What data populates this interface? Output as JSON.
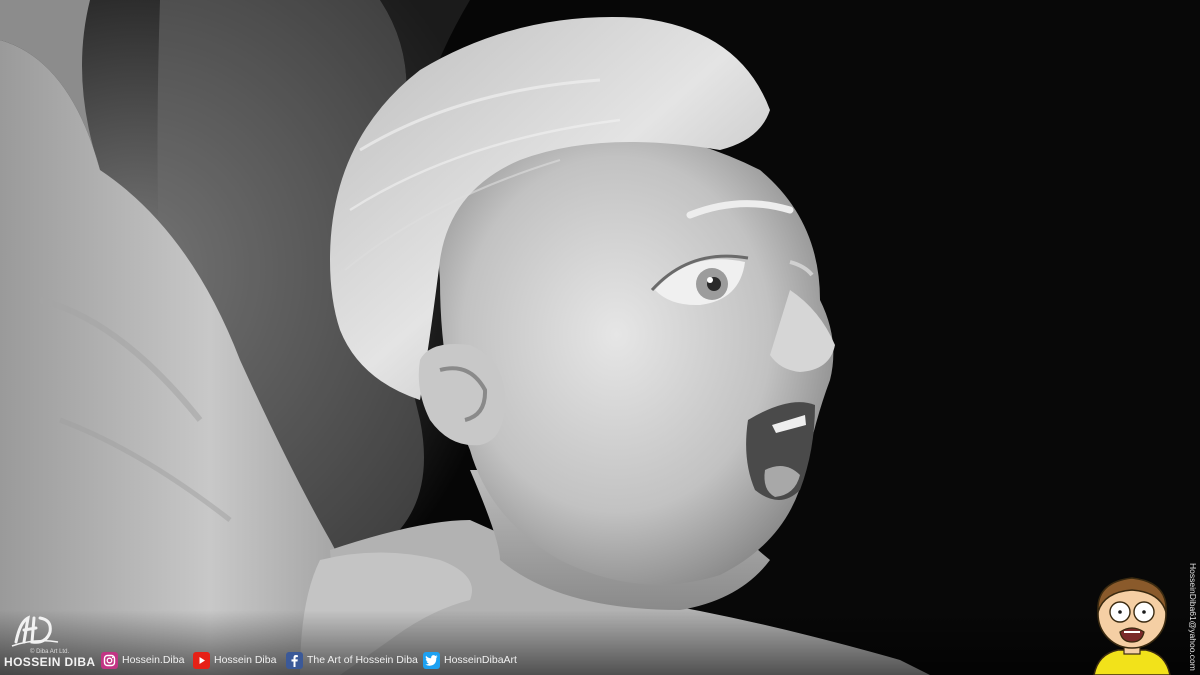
{
  "logo": {
    "ltd_text": "© Diba Art Ltd.",
    "name": "HOSSEIN DIBA"
  },
  "social": [
    {
      "icon": "instagram-icon",
      "label": "Hossein.Diba",
      "color": "#c13584"
    },
    {
      "icon": "youtube-icon",
      "label": "Hossein Diba",
      "color": "#e62117"
    },
    {
      "icon": "facebook-icon",
      "label": "The Art of Hossein Diba",
      "color": "#3b5998"
    },
    {
      "icon": "twitter-icon",
      "label": "HosseinDibaArt",
      "color": "#1da1f2"
    }
  ],
  "email": "HosseinDiba61@yahoo.com",
  "palette": {
    "background": "#0b0b0b",
    "skin": "#d4d4d4",
    "character_skin": "#f5cfa4",
    "character_hair": "#8a5a2b",
    "character_shirt": "#f2e21a"
  }
}
